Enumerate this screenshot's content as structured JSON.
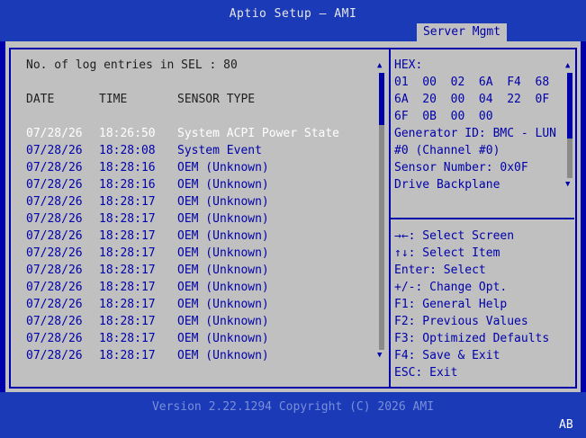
{
  "header": {
    "title": "Aptio Setup – AMI",
    "tab": "Server Mgmt"
  },
  "log": {
    "summary": "No. of log entries in SEL : 80",
    "columns": {
      "date": "DATE",
      "time": "TIME",
      "sensor": "SENSOR TYPE"
    },
    "rows": [
      {
        "date": "07/28/26",
        "time": "18:26:50",
        "sensor": "System ACPI Power State",
        "selected": true
      },
      {
        "date": "07/28/26",
        "time": "18:28:08",
        "sensor": "System Event"
      },
      {
        "date": "07/28/26",
        "time": "18:28:16",
        "sensor": "OEM (Unknown)"
      },
      {
        "date": "07/28/26",
        "time": "18:28:16",
        "sensor": "OEM (Unknown)"
      },
      {
        "date": "07/28/26",
        "time": "18:28:17",
        "sensor": "OEM (Unknown)"
      },
      {
        "date": "07/28/26",
        "time": "18:28:17",
        "sensor": "OEM (Unknown)"
      },
      {
        "date": "07/28/26",
        "time": "18:28:17",
        "sensor": "OEM (Unknown)"
      },
      {
        "date": "07/28/26",
        "time": "18:28:17",
        "sensor": "OEM (Unknown)"
      },
      {
        "date": "07/28/26",
        "time": "18:28:17",
        "sensor": "OEM (Unknown)"
      },
      {
        "date": "07/28/26",
        "time": "18:28:17",
        "sensor": "OEM (Unknown)"
      },
      {
        "date": "07/28/26",
        "time": "18:28:17",
        "sensor": "OEM (Unknown)"
      },
      {
        "date": "07/28/26",
        "time": "18:28:17",
        "sensor": "OEM (Unknown)"
      },
      {
        "date": "07/28/26",
        "time": "18:28:17",
        "sensor": "OEM (Unknown)"
      },
      {
        "date": "07/28/26",
        "time": "18:28:17",
        "sensor": "OEM (Unknown)"
      }
    ]
  },
  "detail": {
    "lines": [
      "HEX:",
      "01  00  02  6A  F4  68",
      "6A  20  00  04  22  0F",
      "6F  0B  00  00",
      "Generator ID: BMC - LUN",
      "#0 (Channel #0)",
      "Sensor Number: 0x0F",
      "Drive Backplane"
    ]
  },
  "help": {
    "items": [
      "→←: Select Screen",
      "↑↓: Select Item",
      "Enter: Select",
      "+/-: Change Opt.",
      "F1: General Help",
      "F2: Previous Values",
      "F3: Optimized Defaults",
      "F4: Save & Exit",
      "ESC: Exit"
    ]
  },
  "footer": {
    "version": "Version 2.22.1294 Copyright (C) 2026 AMI",
    "ab": "AB"
  }
}
